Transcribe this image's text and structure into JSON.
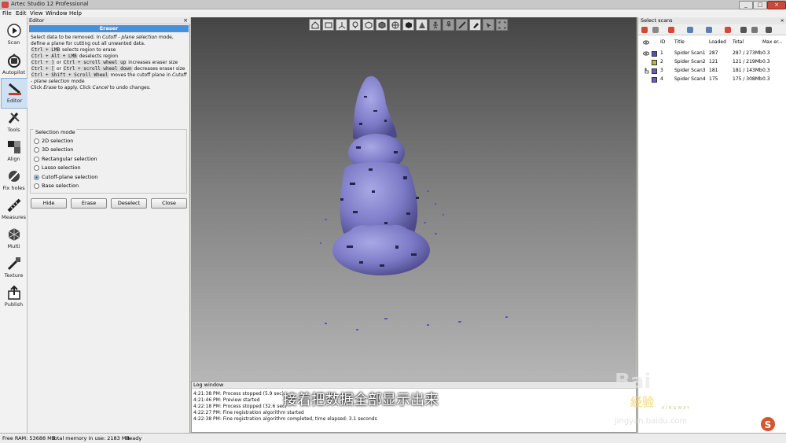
{
  "window": {
    "title": "Artec Studio 12 Professional",
    "min_label": "_",
    "max_label": "□",
    "close_label": "×"
  },
  "menu": [
    "File",
    "Edit",
    "View",
    "Window",
    "Help"
  ],
  "tools": [
    {
      "label": "Scan",
      "icon": "play-icon"
    },
    {
      "label": "Autopilot",
      "icon": "autopilot-icon"
    },
    {
      "label": "Editor",
      "icon": "eraser-icon"
    },
    {
      "label": "Tools",
      "icon": "tools-icon"
    },
    {
      "label": "Align",
      "icon": "align-icon"
    },
    {
      "label": "Fix holes",
      "icon": "fix-holes-icon"
    },
    {
      "label": "Measures",
      "icon": "ruler-icon"
    },
    {
      "label": "Multi",
      "icon": "multi-icon"
    },
    {
      "label": "Texture",
      "icon": "texture-icon"
    },
    {
      "label": "Publish",
      "icon": "publish-icon"
    }
  ],
  "editor": {
    "panel_title": "Editor",
    "tool_title": "Eraser",
    "close_label": "×",
    "help": {
      "p1a": "Select data to be removed. In ",
      "p1b": "Cutoff - plane selection",
      "p1c": " mode, define a plane for cutting out all unwanted data.",
      "k1": "Ctrl + LMB",
      "t1": " selects region to erase",
      "k2": "Ctrl + Alt + LMB",
      "t2": " deselects region",
      "k3": "Ctrl + ]",
      "t3a": " or ",
      "k3b": "Ctrl + scroll wheel up",
      "t3": " increases eraser size",
      "k4": "Ctrl + [",
      "t4a": " or ",
      "k4b": "Ctrl + scroll wheel down",
      "t4": " decreases eraser size",
      "k5": "Ctrl + Shift + Scroll Wheel",
      "t5a": " moves the cutoff plane in ",
      "t5b": "Cutoff - plane selection",
      "t5c": " mode",
      "p6a": "Click ",
      "p6b": "Erase",
      "p6c": " to apply. Click ",
      "p6d": "Cancel",
      "p6e": " to undo changes."
    },
    "selection_mode_label": "Selection mode",
    "modes": [
      "2D selection",
      "3D selection",
      "Rectangular selection",
      "Lasso selection",
      "Cutoff-plane selection",
      "Base selection"
    ],
    "selected_mode": "Cutoff-plane selection",
    "buttons": {
      "hide": "Hide",
      "erase": "Erase",
      "deselect": "Deselect",
      "close": "Close"
    }
  },
  "viewport_toolbar": [
    "home-icon",
    "view-icon",
    "axes-icon",
    "light-icon",
    "wireframe-icon",
    "solid-icon",
    "sphere-icon",
    "cube-icon",
    "texture-toggle-icon",
    "person-icon",
    "person-outline-icon",
    "ruler-icon",
    "eraser-icon",
    "select-icon",
    "zoom-fit-icon"
  ],
  "log": {
    "title": "Log window",
    "lines": [
      "4:21:38 PM: Process stopped (5.9 sec)",
      "4:21:46 PM: Preview started",
      "4:22:18 PM: Process stopped (32.6 sec)",
      "4:22:27 PM: Fine registration algorithm started",
      "4:22:38 PM: Fine registration algorithm completed, time elapsed: 3.1 seconds"
    ]
  },
  "scans": {
    "title": "Select scans",
    "close_label": "×",
    "columns": [
      "ID",
      "Title",
      "Loaded",
      "Total",
      "Max er..."
    ],
    "rows": [
      {
        "id": "1",
        "title": "Spider Scan1",
        "loaded": "287",
        "total": "287 / 273Mb",
        "max": "0.3",
        "color": "#5a4fb0",
        "visible": true
      },
      {
        "id": "2",
        "title": "Spider Scan2",
        "loaded": "121",
        "total": "121 / 219Mb",
        "max": "0.3",
        "color": "#b8b84a",
        "visible": false
      },
      {
        "id": "3",
        "title": "Spider Scan3",
        "loaded": "181",
        "total": "181 / 143Mb",
        "max": "0.3",
        "color": "#6a5acd",
        "visible": false
      },
      {
        "id": "4",
        "title": "Spider Scan4",
        "loaded": "175",
        "total": "175 / 308Mb",
        "max": "0.3",
        "color": "#6a5acd",
        "visible": false
      }
    ]
  },
  "status": {
    "ram": "Free RAM: 53688 MB",
    "mem": "Total memory in use: 2183 MB",
    "state": "Ready"
  },
  "subtitle": "接着把数据全部显示出来",
  "watermark": {
    "bai": "Bai",
    "jy": "经验",
    "kw": "KINGWAY",
    "url": "jingyan.baidu.com"
  },
  "corner_logo": "S"
}
